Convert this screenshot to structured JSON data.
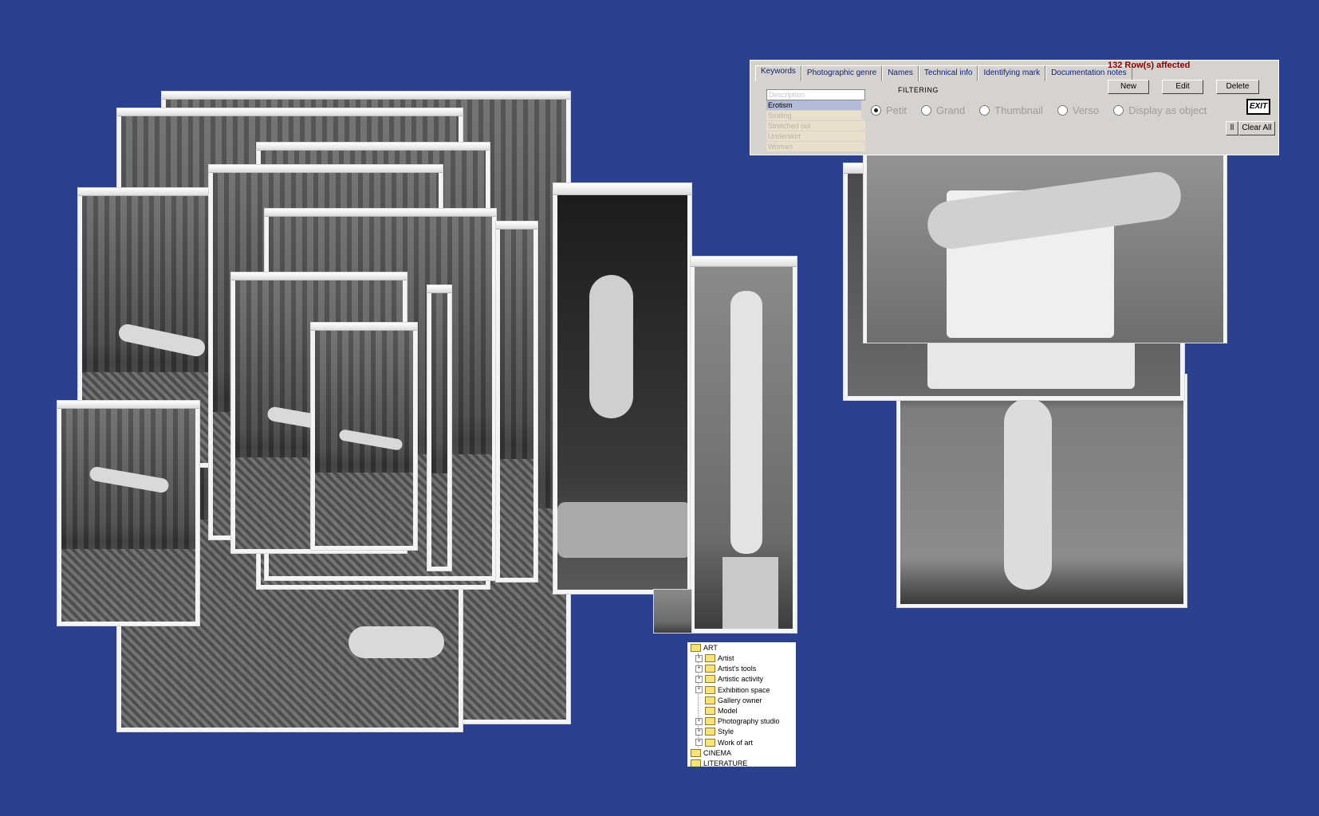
{
  "tabs": [
    "Keywords",
    "Photographic genre",
    "Names",
    "Technical info",
    "Identifying mark",
    "Documentation notes"
  ],
  "status": "132 Row(s) affected",
  "buttons": {
    "new": "New",
    "edit": "Edit",
    "delete": "Delete",
    "exit": "EXIT",
    "clear_all": "Clear All",
    "all_partial": "ll"
  },
  "keywords_header": "Description",
  "keywords": [
    "Erotism",
    "Smiling",
    "Stretched out",
    "Underskirt",
    "Woman"
  ],
  "filtering_label": "FILTERING",
  "radios": [
    "Petit",
    "Grand",
    "Thumbnail",
    "Verso",
    "Display as object"
  ],
  "tree": {
    "root": "ART",
    "children": [
      "Artist",
      "Artist's tools",
      "Artistic activity",
      "Exhibition space",
      "Gallery owner",
      "Model",
      "Photography studio",
      "Style",
      "Work of art"
    ],
    "siblings": [
      "CINEMA",
      "LITERATURE"
    ]
  },
  "colors": {
    "background": "#2b4190",
    "window": "#d6d3ce",
    "status": "#8b0000"
  }
}
